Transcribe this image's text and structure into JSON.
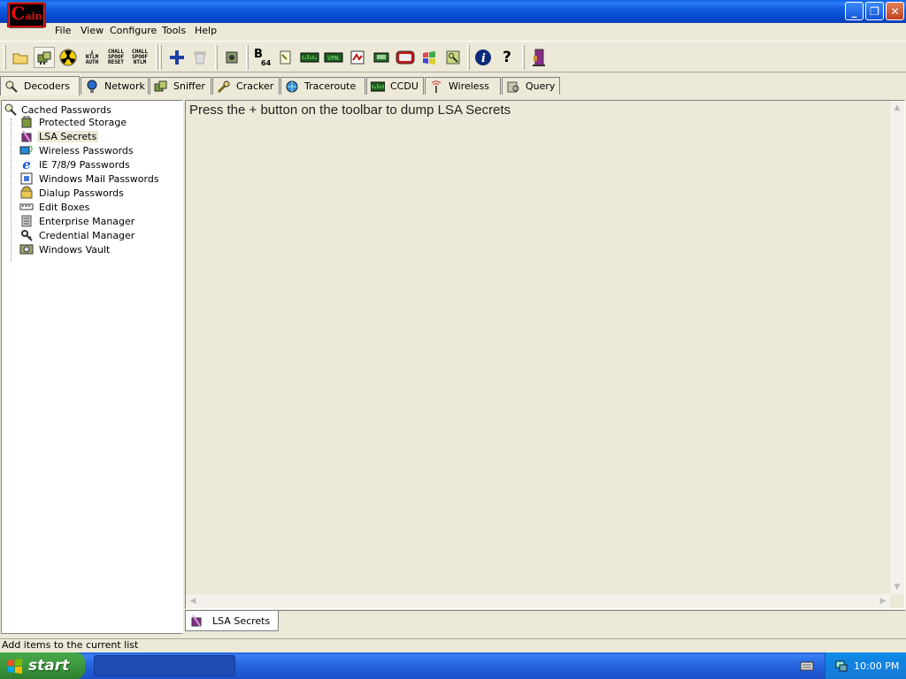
{
  "titlebar": {
    "logo_text": "ain",
    "logo_prefix": "C"
  },
  "menu": [
    "File",
    "View",
    "Configure",
    "Tools",
    "Help"
  ],
  "toolbar": {
    "ntlm_auth": [
      "NTLM",
      "AUTH"
    ],
    "chall_spoof_reset": [
      "CHALL",
      "SPOOF",
      "RESET"
    ],
    "chall_spoof_ntlm": [
      "CHALL",
      "SPOOF",
      "NTLM"
    ],
    "b64_big": "B",
    "b64_small": "64"
  },
  "tabs": [
    "Decoders",
    "Network",
    "Sniffer",
    "Cracker",
    "Traceroute",
    "CCDU",
    "Wireless",
    "Query"
  ],
  "tree": {
    "root": "Cached Passwords",
    "items": [
      "Protected Storage",
      "LSA Secrets",
      "Wireless Passwords",
      "IE 7/8/9 Passwords",
      "Windows Mail Passwords",
      "Dialup Passwords",
      "Edit Boxes",
      "Enterprise Manager",
      "Credential Manager",
      "Windows Vault"
    ]
  },
  "content": {
    "message": "Press the + button on the toolbar to dump LSA Secrets"
  },
  "subtab": "LSA Secrets",
  "status": "Add items to the current list",
  "taskbar": {
    "start_label": "start",
    "clock": "10:00 PM"
  }
}
